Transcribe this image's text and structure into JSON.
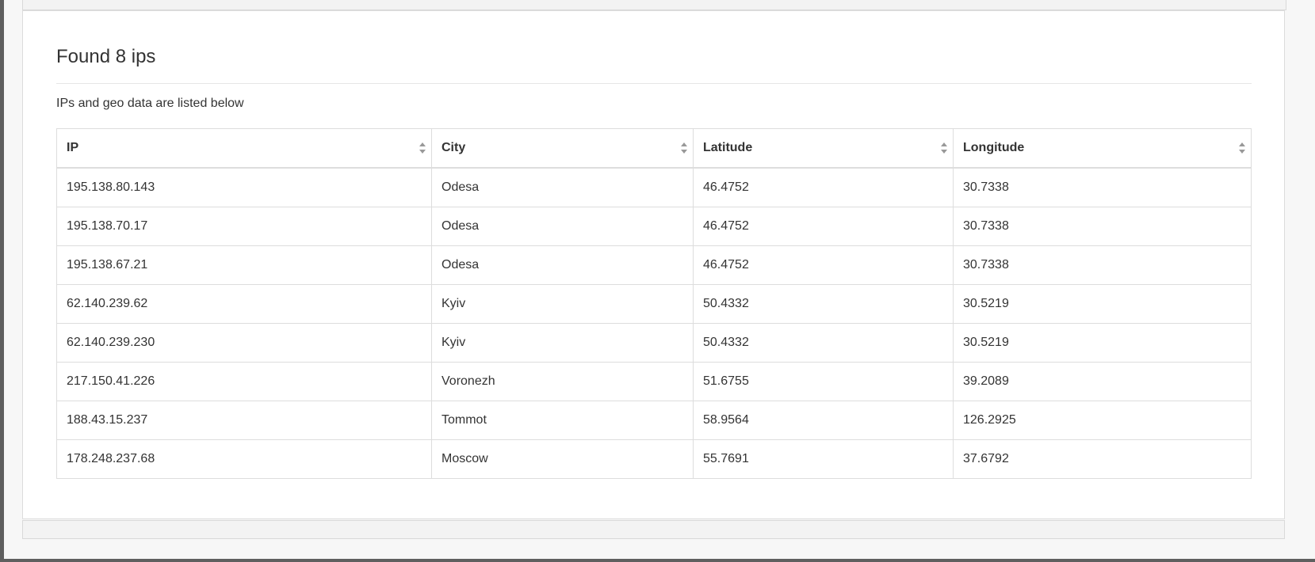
{
  "panel": {
    "title": "Found 8 ips",
    "subtitle": "IPs and geo data are listed below"
  },
  "table": {
    "headers": [
      "IP",
      "City",
      "Latitude",
      "Longitude"
    ],
    "rows": [
      [
        "195.138.80.143",
        "Odesa",
        "46.4752",
        "30.7338"
      ],
      [
        "195.138.70.17",
        "Odesa",
        "46.4752",
        "30.7338"
      ],
      [
        "195.138.67.21",
        "Odesa",
        "46.4752",
        "30.7338"
      ],
      [
        "62.140.239.62",
        "Kyiv",
        "50.4332",
        "30.5219"
      ],
      [
        "62.140.239.230",
        "Kyiv",
        "50.4332",
        "30.5219"
      ],
      [
        "217.150.41.226",
        "Voronezh",
        "51.6755",
        "39.2089"
      ],
      [
        "188.43.15.237",
        "Tommot",
        "58.9564",
        "126.2925"
      ],
      [
        "178.248.237.68",
        "Moscow",
        "55.7691",
        "37.6792"
      ]
    ]
  },
  "icons": {
    "sort": "sort-both-icon"
  }
}
